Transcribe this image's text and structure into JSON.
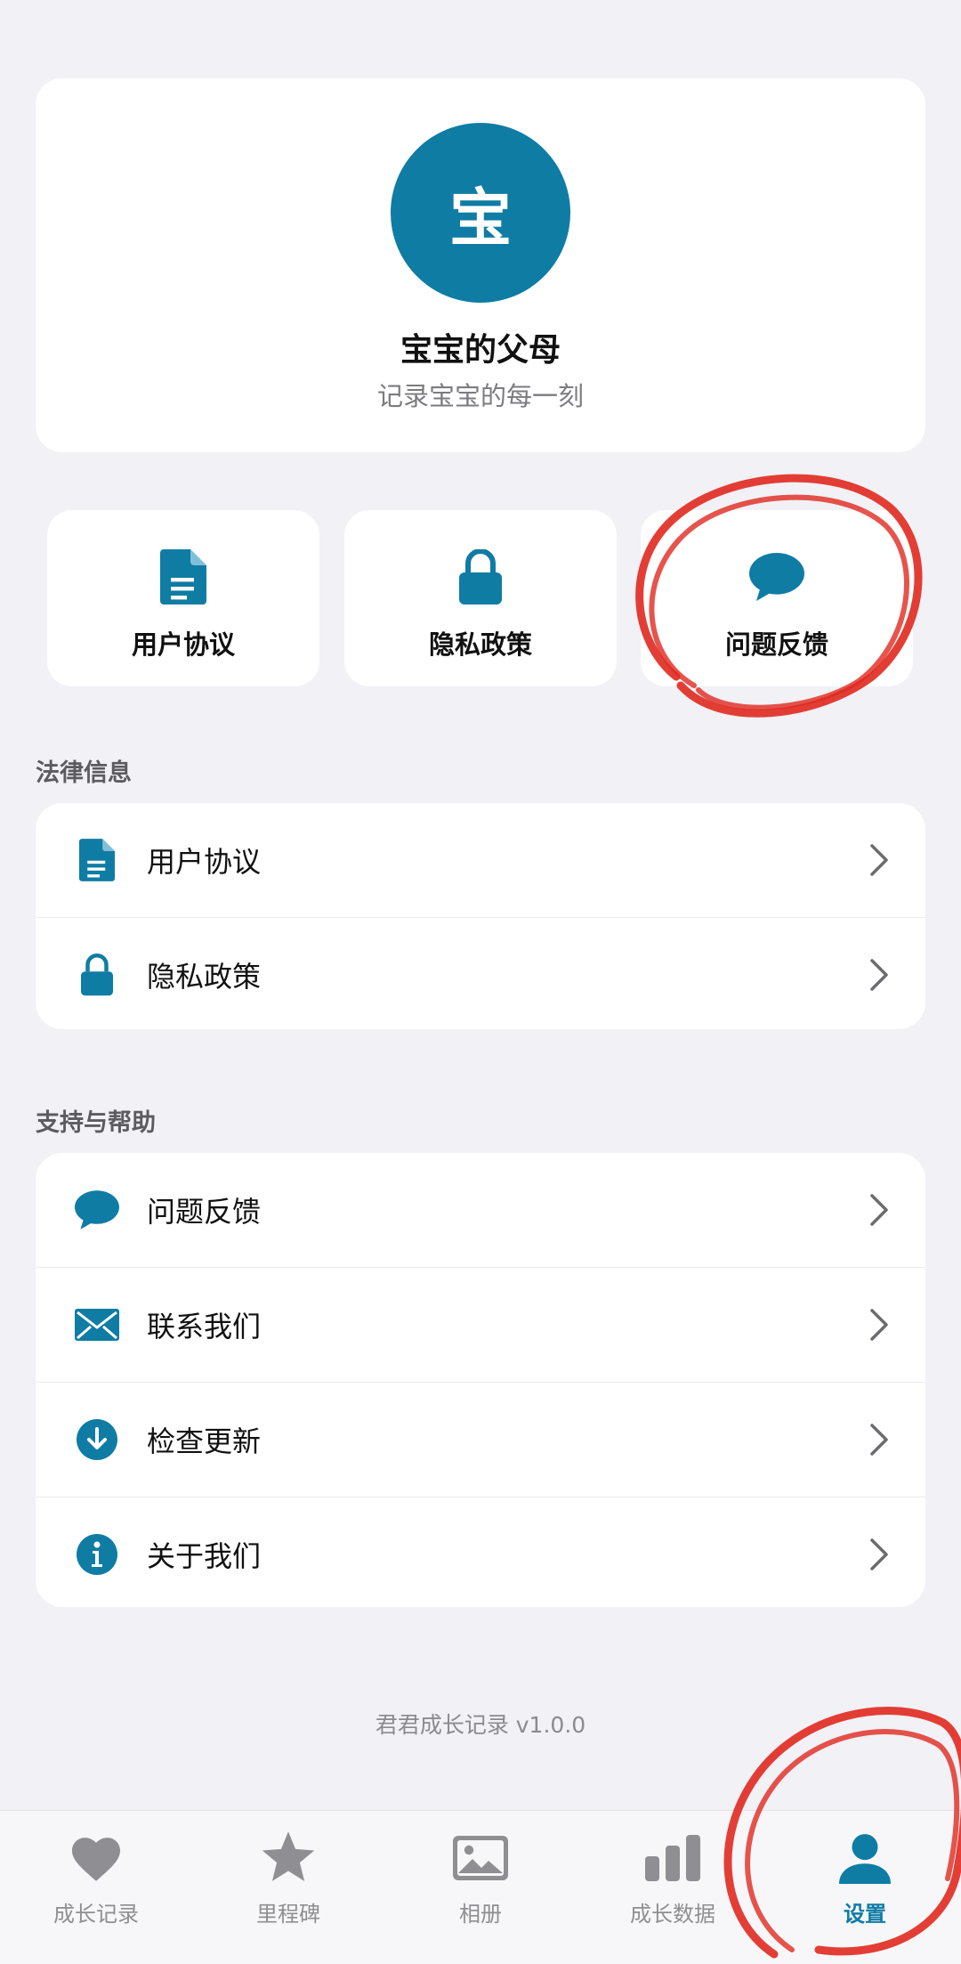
{
  "colors": {
    "accent": "#0f7ca4",
    "inactive": "#8e8e93",
    "annotation": "#e0291f"
  },
  "profile": {
    "avatar_char": "宝",
    "name": "宝宝的父母",
    "subtitle": "记录宝宝的每一刻"
  },
  "quick_actions": [
    {
      "label": "用户协议",
      "icon": "document-icon"
    },
    {
      "label": "隐私政策",
      "icon": "lock-icon"
    },
    {
      "label": "问题反馈",
      "icon": "chat-bubble-icon"
    }
  ],
  "legal": {
    "title": "法律信息",
    "items": [
      {
        "label": "用户协议",
        "icon": "document-icon"
      },
      {
        "label": "隐私政策",
        "icon": "lock-icon"
      }
    ]
  },
  "support": {
    "title": "支持与帮助",
    "items": [
      {
        "label": "问题反馈",
        "icon": "chat-bubble-icon"
      },
      {
        "label": "联系我们",
        "icon": "envelope-icon"
      },
      {
        "label": "检查更新",
        "icon": "download-icon"
      },
      {
        "label": "关于我们",
        "icon": "info-icon"
      }
    ]
  },
  "version_text": "君君成长记录 v1.0.0",
  "tabbar": {
    "active": "设置",
    "tabs": [
      {
        "label": "成长记录",
        "icon": "heart-icon"
      },
      {
        "label": "里程碑",
        "icon": "star-icon"
      },
      {
        "label": "相册",
        "icon": "photo-icon"
      },
      {
        "label": "成长数据",
        "icon": "bar-chart-icon"
      },
      {
        "label": "设置",
        "icon": "person-icon"
      }
    ]
  }
}
